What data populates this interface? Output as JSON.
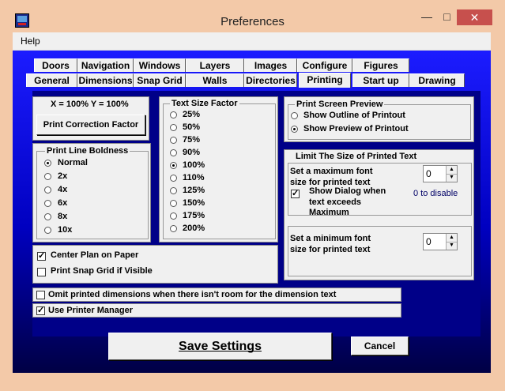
{
  "window": {
    "title": "Preferences",
    "minimize_glyph": "—",
    "maximize_glyph": "□",
    "close_glyph": "✕"
  },
  "menu": {
    "help": "Help"
  },
  "tabs": {
    "row1": [
      "Doors",
      "Navigation",
      "Windows",
      "Layers",
      "Images",
      "Configure",
      "Figures"
    ],
    "row2": [
      "General",
      "Dimensions",
      "Snap Grid",
      "Walls",
      "Directories",
      "Printing",
      "Start up",
      "Drawing"
    ],
    "active": "Printing"
  },
  "correction": {
    "scale_label": "X = 100%   Y = 100%",
    "button": "Print Correction Factor"
  },
  "boldness": {
    "title": "Print Line Boldness",
    "options": [
      "Normal",
      "2x",
      "4x",
      "6x",
      "8x",
      "10x"
    ],
    "selected": "Normal"
  },
  "text_size": {
    "title": "Text Size Factor",
    "options": [
      "25%",
      "50%",
      "75%",
      "90%",
      "100%",
      "110%",
      "125%",
      "150%",
      "175%",
      "200%"
    ],
    "selected": "100%"
  },
  "preview": {
    "title": "Print Screen Preview",
    "options": [
      "Show Outline of Printout",
      "Show  Preview of Printout"
    ],
    "selected": "Show  Preview of Printout"
  },
  "limit": {
    "title": "Limit The Size of Printed Text",
    "max_label_1": "Set a maximum font",
    "max_label_2": "size for printed text",
    "max_value": "0",
    "disable_hint": "0 to disable",
    "dialog_label_1": "Show Dialog when",
    "dialog_label_2": "text exceeds",
    "dialog_label_3": "Maximum",
    "dialog_checked": true,
    "min_label_1": "Set a minimum font",
    "min_label_2": "size for printed text",
    "min_value": "0"
  },
  "options": {
    "center_plan": "Center Plan on Paper",
    "center_plan_checked": true,
    "snap_grid": "Print Snap Grid if Visible",
    "snap_grid_checked": false,
    "omit_dims": "Omit printed dimensions when there isn't room for the dimension text",
    "omit_dims_checked": false,
    "printer_manager": "Use Printer Manager",
    "printer_manager_checked": true
  },
  "buttons": {
    "save": "Save Settings",
    "cancel": "Cancel"
  }
}
